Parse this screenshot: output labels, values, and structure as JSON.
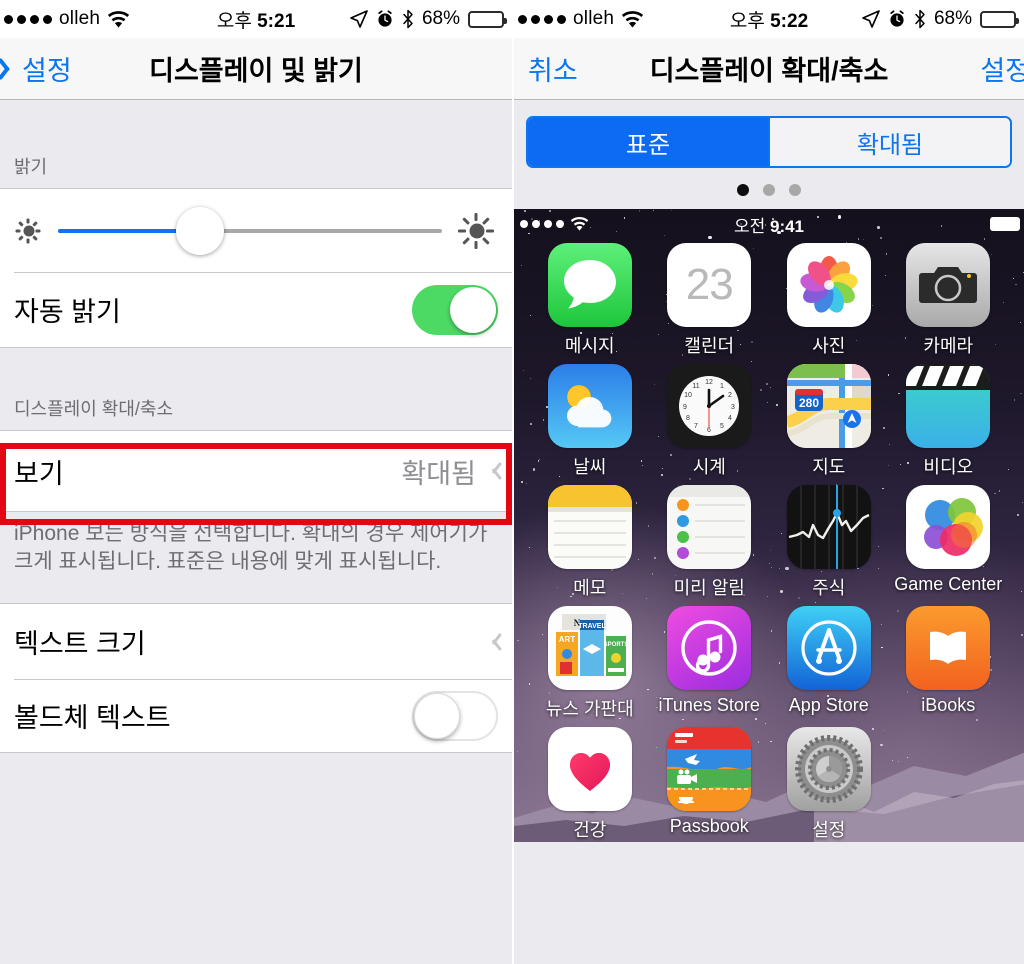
{
  "left_panel": {
    "status_bar": {
      "signal_dots": 5,
      "carrier": "olleh",
      "wifi_icon": "wifi-icon",
      "time": "5:21",
      "ampm": "오후",
      "location_icon": "location-arrow-icon",
      "alarm_icon": "alarm-clock-icon",
      "bluetooth_icon": "bluetooth-icon",
      "battery_percent": "68%",
      "battery_level": 68
    },
    "nav": {
      "back_label": "설정",
      "back_icon": "chevron-left-icon",
      "title": "디스플레이 및 밝기"
    },
    "brightness": {
      "section_header": "밝기",
      "slider": {
        "value_percent": 37,
        "low_icon": "brightness-low-sun-icon",
        "high_icon": "brightness-high-sun-icon"
      },
      "auto_brightness": {
        "label": "자동 밝기",
        "toggle_state": "on"
      }
    },
    "display_zoom": {
      "section_header": "디스플레이 확대/축소",
      "view_row": {
        "label": "보기",
        "value": "확대됨",
        "chevron_icon": "chevron-right-icon",
        "highlighted": true,
        "highlight_color": "#e30613"
      },
      "footnote": "iPhone 보는 방식을 선택합니다. 확대의 경우 제어기가 크게 표시됩니다. 표준은 내용에 맞게 표시됩니다."
    },
    "text_rows": [
      {
        "label": "텍스트 크기",
        "type": "disclosure",
        "chevron_icon": "chevron-right-icon"
      },
      {
        "label": "볼드체 텍스트",
        "type": "toggle",
        "toggle_state": "off"
      }
    ]
  },
  "right_panel": {
    "status_bar": {
      "signal_dots": 5,
      "carrier": "olleh",
      "wifi_icon": "wifi-icon",
      "time": "5:22",
      "ampm": "오후",
      "location_icon": "location-arrow-icon",
      "alarm_icon": "alarm-clock-icon",
      "bluetooth_icon": "bluetooth-icon",
      "battery_percent": "68%",
      "battery_level": 68
    },
    "nav": {
      "cancel_label": "취소",
      "title": "디스플레이 확대/축소",
      "set_label": "설정"
    },
    "segmented_control": {
      "options": [
        "표준",
        "확대됨"
      ],
      "selected_index": 0,
      "accent_color": "#0b76f0"
    },
    "page_dots": {
      "count": 3,
      "active_index": 0
    },
    "preview": {
      "status_bar": {
        "signal_dots": 4,
        "wifi_icon": "wifi-icon",
        "ampm": "오전",
        "time": "9:41"
      },
      "apps": [
        {
          "label": "메시지",
          "icon": "messages-icon"
        },
        {
          "label": "캘린더",
          "icon": "calendar-icon",
          "day": "23"
        },
        {
          "label": "사진",
          "icon": "photos-icon"
        },
        {
          "label": "카메라",
          "icon": "camera-icon"
        },
        {
          "label": "날씨",
          "icon": "weather-icon"
        },
        {
          "label": "시계",
          "icon": "clock-icon"
        },
        {
          "label": "지도",
          "icon": "maps-icon",
          "route": "280"
        },
        {
          "label": "비디오",
          "icon": "videos-icon"
        },
        {
          "label": "메모",
          "icon": "notes-icon"
        },
        {
          "label": "미리 알림",
          "icon": "reminders-icon"
        },
        {
          "label": "주식",
          "icon": "stocks-icon"
        },
        {
          "label": "Game Center",
          "icon": "game-center-icon"
        },
        {
          "label": "뉴스 가판대",
          "icon": "newsstand-icon"
        },
        {
          "label": "iTunes Store",
          "icon": "itunes-store-icon"
        },
        {
          "label": "App Store",
          "icon": "app-store-icon"
        },
        {
          "label": "iBooks",
          "icon": "ibooks-icon"
        },
        {
          "label": "건강",
          "icon": "health-icon"
        },
        {
          "label": "Passbook",
          "icon": "passbook-icon"
        },
        {
          "label": "설정",
          "icon": "settings-gear-icon"
        }
      ]
    }
  }
}
